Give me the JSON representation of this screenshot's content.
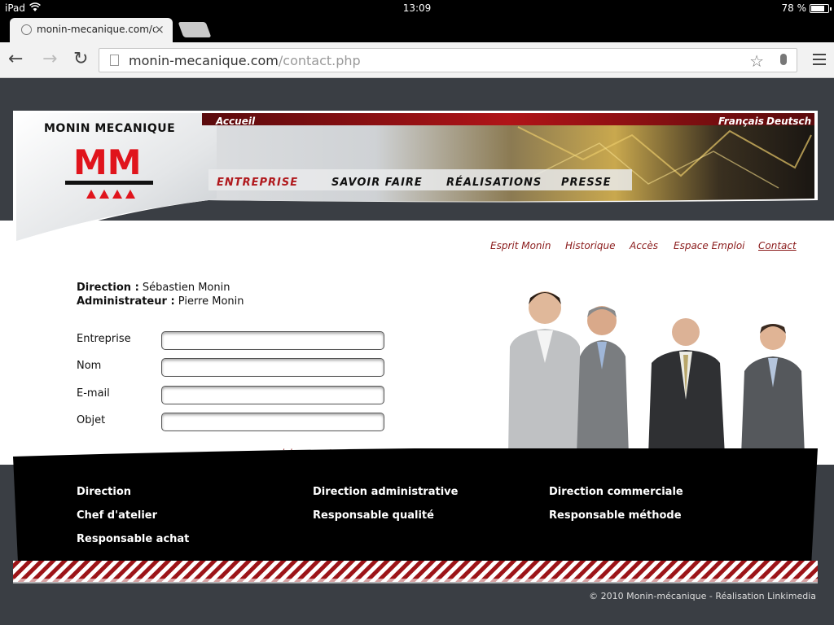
{
  "status": {
    "device": "iPad",
    "time": "13:09",
    "battery": "78 %"
  },
  "browser": {
    "tab_title": "monin-mecanique.com/co",
    "url_host": "monin-mecanique.com",
    "url_path": "/contact.php"
  },
  "site": {
    "brand": "MONIN MECANIQUE",
    "logo_text": "MM",
    "home_link": "Accueil",
    "languages": [
      "Français",
      "Deutsch"
    ],
    "main_nav": [
      "ENTREPRISE",
      "SAVOIR FAIRE",
      "RÉALISATIONS",
      "PRESSE"
    ],
    "sub_nav": [
      "Esprit Monin",
      "Historique",
      "Accès",
      "Espace Emploi",
      "Contact"
    ],
    "contacts": [
      {
        "role": "Direction :",
        "name": " Sébastien Monin"
      },
      {
        "role": "Administrateur :",
        "name": " Pierre Monin"
      }
    ],
    "form": {
      "fields": [
        "Entreprise",
        "Nom",
        "E-mail",
        "Objet"
      ],
      "message_link": "» saisissez votre message"
    },
    "footer_links": [
      "Direction",
      "Direction administrative",
      "Direction commerciale",
      "Chef d'atelier",
      "Responsable qualité",
      "Responsable méthode",
      "Responsable achat"
    ],
    "copyright": "© 2010 Monin-mécanique - Réalisation Linkimedia",
    "colors": {
      "accent": "#b0181c",
      "link": "#8a1a1a",
      "page_bg": "#3a3e44"
    }
  }
}
